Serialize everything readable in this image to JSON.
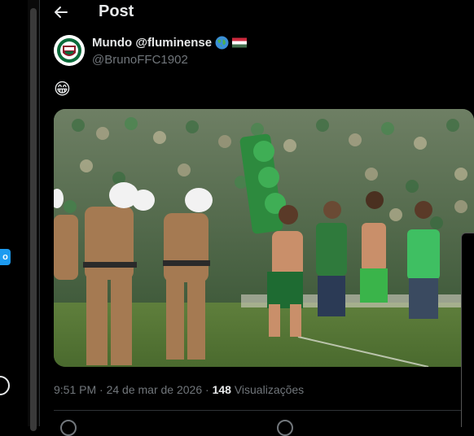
{
  "header": {
    "back_icon": "arrow-left-icon",
    "title": "Post"
  },
  "author": {
    "name": "Mundo @fluminense",
    "name_emojis": [
      "globe-icon",
      "hungary-flag-icon"
    ],
    "handle": "@BrunoFFC1902",
    "avatar": "club-crest-avatar"
  },
  "post": {
    "text_emoji": "😁",
    "media": "photo-riot-police-fans-stadium"
  },
  "meta": {
    "time": "9:51 PM",
    "separator": "·",
    "date": "24 de mar de 2026",
    "views_count": "148",
    "views_label": "Visualizações"
  },
  "left_rail": {
    "chip_label": "o"
  },
  "colors": {
    "background": "#000000",
    "text_primary": "#e7e9ea",
    "text_secondary": "#71767b",
    "divider": "#2f3336",
    "accent": "#1d9bf0"
  }
}
